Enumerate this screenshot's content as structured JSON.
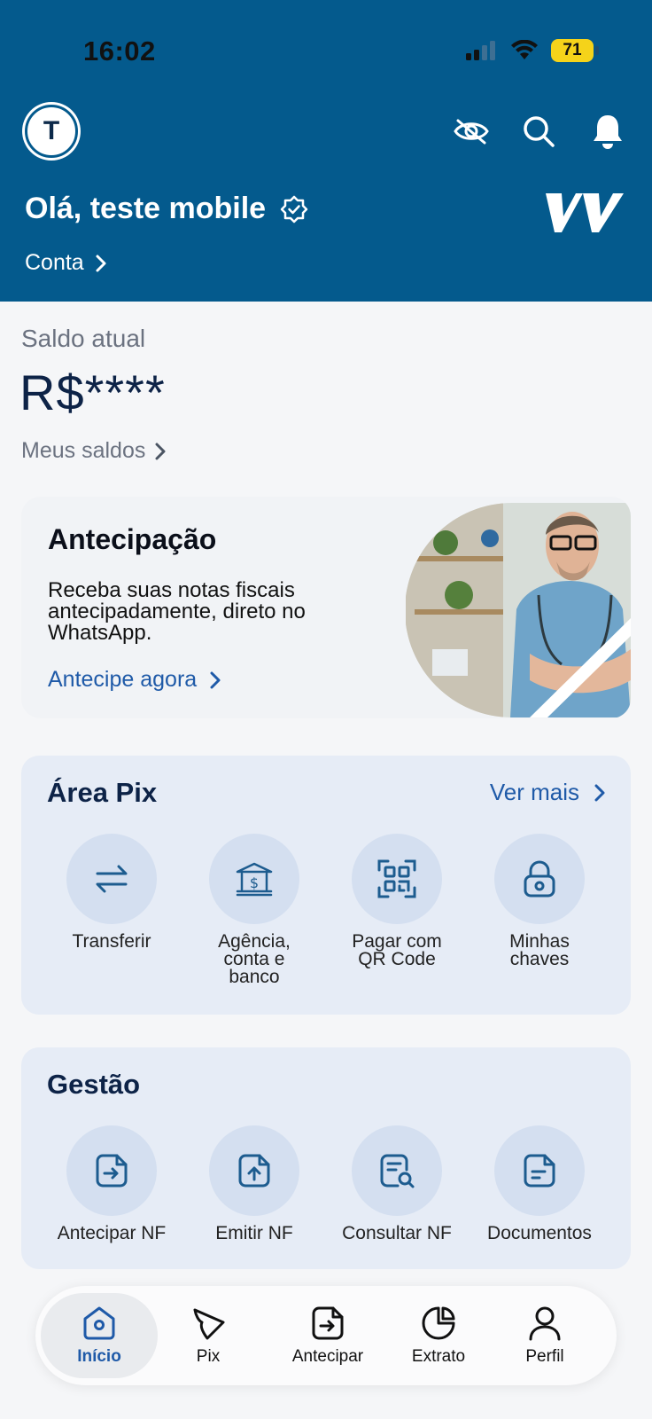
{
  "status_bar": {
    "time": "16:02",
    "battery": "71"
  },
  "header": {
    "avatar_initial": "T",
    "greeting": "Olá, teste mobile",
    "account_link": "Conta",
    "colors": {
      "background": "#045a8d",
      "text": "#ffffff"
    },
    "icons": [
      "eye-off-icon",
      "search-icon",
      "bell-icon",
      "verified-badge-icon"
    ]
  },
  "balance": {
    "label": "Saldo atual",
    "value": "R$****",
    "link": "Meus saldos"
  },
  "promo": {
    "title": "Antecipação",
    "text": "Receba suas notas fiscais antecipadamente, direto no WhatsApp.",
    "link": "Antecipe agora"
  },
  "pix_area": {
    "title": "Área Pix",
    "more": "Ver mais",
    "actions": [
      {
        "label": "Transferir",
        "icon": "transfer-arrows-icon"
      },
      {
        "label": "Agência,\nconta e\nbanco",
        "icon": "bank-icon"
      },
      {
        "label": "Pagar com\nQR Code",
        "icon": "qr-code-icon"
      },
      {
        "label": "Minhas\nchaves",
        "icon": "lock-icon"
      }
    ]
  },
  "gestao": {
    "title": "Gestão",
    "actions": [
      {
        "label": "Antecipar NF",
        "icon": "document-arrow-icon"
      },
      {
        "label": "Emitir NF",
        "icon": "document-upload-icon"
      },
      {
        "label": "Consultar NF",
        "icon": "document-search-icon"
      },
      {
        "label": "Documentos",
        "icon": "document-icon"
      }
    ]
  },
  "bottom_nav": {
    "active": "Início",
    "items": [
      {
        "label": "Início",
        "icon": "home-icon"
      },
      {
        "label": "Pix",
        "icon": "pix-icon"
      },
      {
        "label": "Antecipar",
        "icon": "document-arrow-icon"
      },
      {
        "label": "Extrato",
        "icon": "pie-chart-icon"
      },
      {
        "label": "Perfil",
        "icon": "user-icon"
      }
    ]
  },
  "colors": {
    "accent": "#1f5aa8",
    "dark_text": "#0d2347",
    "section_bg": "#e6ecf6",
    "icon_circle": "#d4dff0"
  }
}
